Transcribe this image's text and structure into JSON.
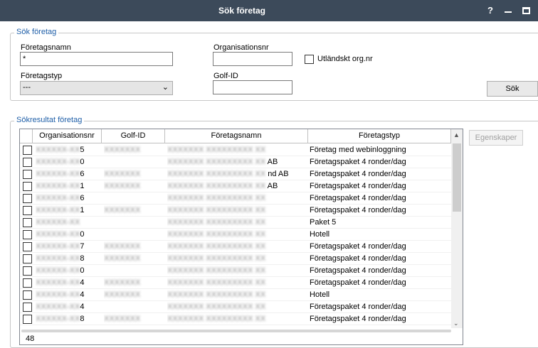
{
  "window": {
    "title": "Sök företag",
    "help_label": "?"
  },
  "search": {
    "legend": "Sök företag",
    "company_name_label": "Företagsnamn",
    "company_name_value": "*",
    "org_nr_label": "Organisationsnr",
    "org_nr_value": "",
    "foreign_org_label": "Utländskt org.nr",
    "company_type_label": "Företagstyp",
    "company_type_value": "---",
    "golf_id_label": "Golf-ID",
    "golf_id_value": "",
    "search_button": "Sök"
  },
  "results": {
    "legend": "Sökresultat företag",
    "properties_button": "Egenskaper",
    "columns": [
      "Organisationsnr",
      "Golf-ID",
      "Företagsnamn",
      "Företagstyp"
    ],
    "rows": [
      {
        "org": "5",
        "golf": "",
        "name": "",
        "type": "Företag med webinloggning"
      },
      {
        "org": "0",
        "golf": "",
        "name": "AB",
        "type": "Företagspaket 4 ronder/dag"
      },
      {
        "org": "6",
        "golf": "",
        "name": "nd AB",
        "type": "Företagspaket 4 ronder/dag"
      },
      {
        "org": "1",
        "golf": "",
        "name": "AB",
        "type": "Företagspaket 4 ronder/dag"
      },
      {
        "org": "6",
        "golf": "",
        "name": "",
        "type": "Företagspaket 4 ronder/dag"
      },
      {
        "org": "1",
        "golf": "",
        "name": "",
        "type": "Företagspaket 4 ronder/dag"
      },
      {
        "org": "",
        "golf": "",
        "name": "",
        "type": "Paket 5"
      },
      {
        "org": "0",
        "golf": "",
        "name": "",
        "type": "Hotell"
      },
      {
        "org": "7",
        "golf": "",
        "name": "",
        "type": "Företagspaket 4 ronder/dag"
      },
      {
        "org": "8",
        "golf": "",
        "name": "",
        "type": "Företagspaket 4 ronder/dag"
      },
      {
        "org": "0",
        "golf": "",
        "name": "",
        "type": "Företagspaket 4 ronder/dag"
      },
      {
        "org": "4",
        "golf": "",
        "name": "",
        "type": "Företagspaket 4 ronder/dag"
      },
      {
        "org": "4",
        "golf": "",
        "name": "",
        "type": "Hotell"
      },
      {
        "org": "4",
        "golf": "",
        "name": "",
        "type": "Företagspaket 4 ronder/dag"
      },
      {
        "org": "8",
        "golf": "",
        "name": "",
        "type": "Företagspaket 4 ronder/dag"
      }
    ],
    "row_count": "48"
  }
}
